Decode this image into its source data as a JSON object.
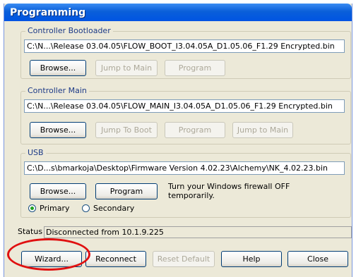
{
  "window": {
    "title": "Programming"
  },
  "bootloader": {
    "label": "Controller Bootloader",
    "path": "C:\\N...\\Release 03.04.05\\FLOW_BOOT_I3.04.05A_D1.05.06_F1.29 Encrypted.bin",
    "browse": "Browse...",
    "jump": "Jump to Main",
    "program": "Program"
  },
  "main": {
    "label": "Controller Main",
    "path": "C:\\N...\\Release 03.04.05\\FLOW_MAIN_I3.04.05A_D1.05.06_F1.29 Encrypted.bin",
    "browse": "Browse...",
    "jump_boot": "Jump To Boot",
    "program": "Program",
    "jump_main": "Jump to Main"
  },
  "usb": {
    "label": "USB",
    "path": "C:\\D...s\\bmarkoja\\Desktop\\Firmware Version 4.02.23\\Alchemy\\NK_4.02.23.bin",
    "browse": "Browse...",
    "program": "Program",
    "note": "Turn your Windows firewall OFF temporarily.",
    "radio_primary": "Primary",
    "radio_secondary": "Secondary",
    "selected": "Primary"
  },
  "status": {
    "label": "Status",
    "value": "Disconnected from 10.1.9.225"
  },
  "footer": {
    "wizard": "Wizard...",
    "reconnect": "Reconnect",
    "reset_default": "Reset Default",
    "help": "Help",
    "close": "Close"
  },
  "colors": {
    "titlebar": "#0054e3",
    "highlight_ring": "#e01010",
    "selected_radio": "#21a121"
  }
}
